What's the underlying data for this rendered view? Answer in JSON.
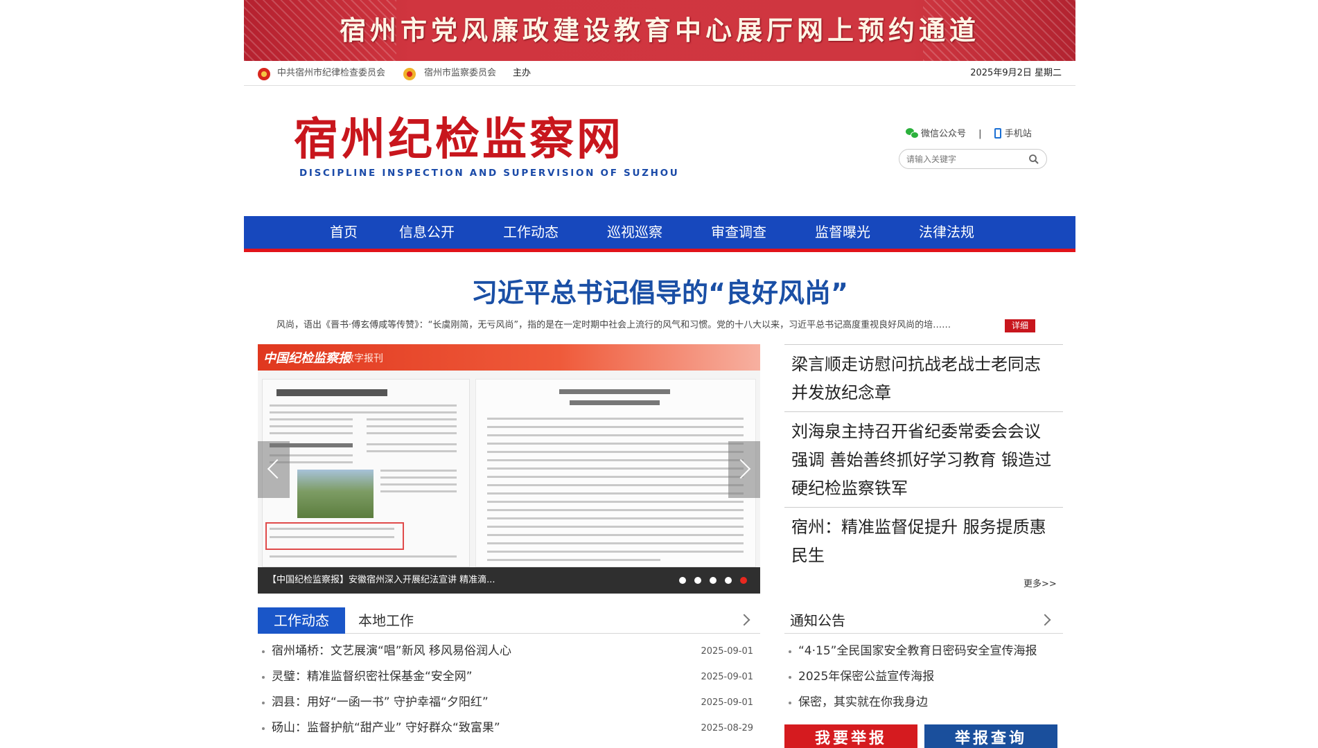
{
  "banner": {
    "title": "宿州市党风廉政建设教育中心展厅网上预约通道"
  },
  "hostbar": {
    "org1": "中共宿州市纪律检查委员会",
    "org2": "宿州市监察委员会",
    "suffix": "主办",
    "date": "2025年9月2日 星期二"
  },
  "logo": {
    "cn": "宿州纪检监察网",
    "en": "DISCIPLINE INSPECTION AND SUPERVISION OF SUZHOU"
  },
  "header_links": {
    "wechat": "微信公众号",
    "divider": "|",
    "mobile": "手机站"
  },
  "search": {
    "placeholder": "请输入关键字"
  },
  "nav": {
    "items": [
      "首页",
      "信息公开",
      "工作动态",
      "巡视巡察",
      "审查调查",
      "监督曝光",
      "法律法规"
    ]
  },
  "headline": {
    "title": "习近平总书记倡导的“良好风尚”",
    "summary": "风尚，语出《晋书·傅玄傅咸等传赞》：“长虞刚简，无亏风尚”，指的是在一定时期中社会上流行的风气和习惯。党的十八大以来，习近平总书记高度重视良好风尚的培……",
    "detail_label": "详细"
  },
  "slider": {
    "paper_logo": "中国纪检监察报",
    "paper_sub": "数字报刊",
    "caption": "【中国纪检监察报】安徽宿州深入开展纪法宣讲 精准滴...",
    "dot_count": 5,
    "active_dot": 5
  },
  "right_news": {
    "items": [
      "梁言顺走访慰问抗战老战士老同志并发放纪念章",
      "刘海泉主持召开省纪委常委会会议强调 善始善终抓好学习教育 锻造过硬纪检监察铁军",
      "宿州：精准监督促提升 服务提质惠民生"
    ],
    "more": "更多>>"
  },
  "tabs": {
    "active": "工作动态",
    "inactive": "本地工作",
    "rows": [
      {
        "title": "宿州埇桥：文艺展演“唱”新风 移风易俗润人心",
        "date": "2025-09-01"
      },
      {
        "title": "灵璧：精准监督织密社保基金“安全网”",
        "date": "2025-09-01"
      },
      {
        "title": "泗县：用好“一函一书” 守护幸福“夕阳红”",
        "date": "2025-09-01"
      },
      {
        "title": "砀山：监督护航“甜产业” 守好群众“致富果”",
        "date": "2025-08-29"
      }
    ]
  },
  "notices": {
    "title": "通知公告",
    "rows": [
      "“4·15”全民国家安全教育日密码安全宣传海报",
      "2025年保密公益宣传海报",
      "保密，其实就在你我身边"
    ]
  },
  "buttons": {
    "report": "我要举报",
    "query": "举报查询"
  },
  "colors": {
    "brand_red": "#c8161d",
    "nav_blue": "#1748bd",
    "headline_blue": "#1a4fa5"
  }
}
